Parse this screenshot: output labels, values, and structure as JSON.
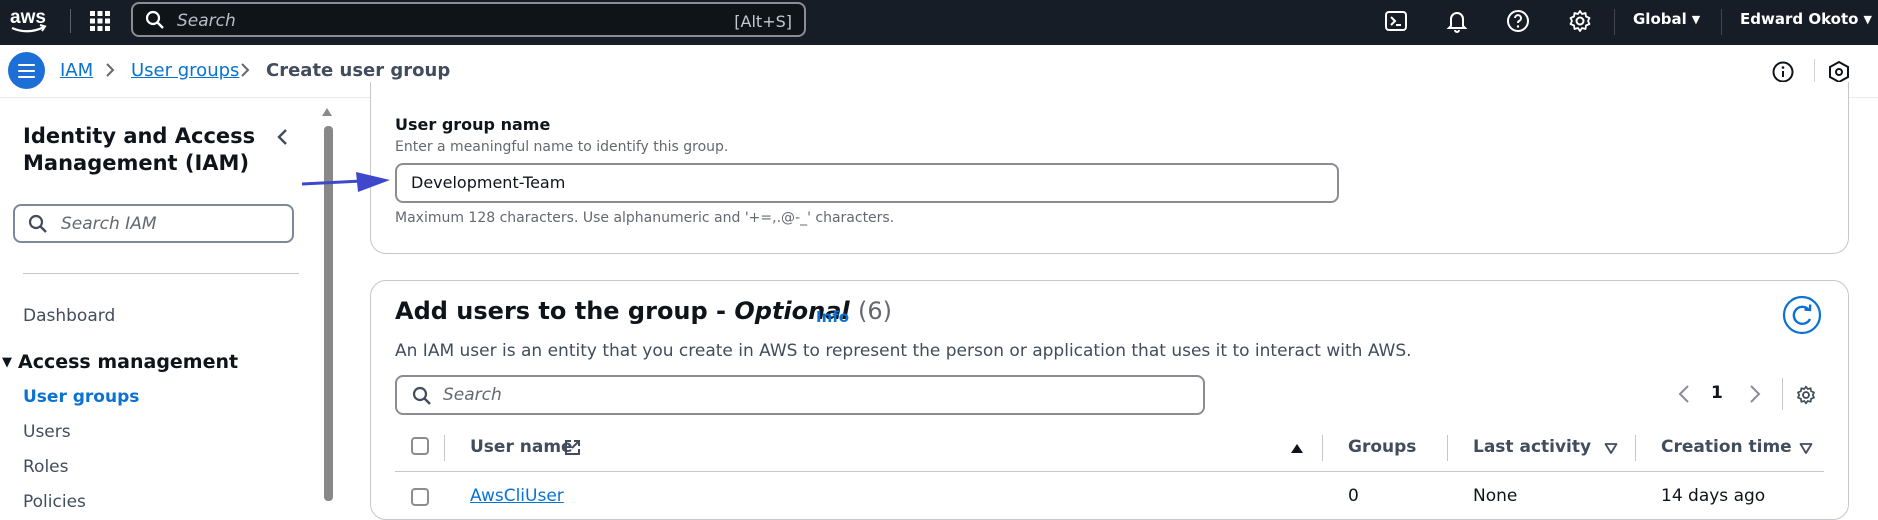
{
  "topnav": {
    "logo": "aws",
    "search_placeholder": "Search",
    "search_shortcut": "[Alt+S]",
    "region": "Global",
    "user": "Edward Okoto",
    "icons": [
      "cloudshell-icon",
      "bell-icon",
      "help-icon",
      "gear-icon"
    ]
  },
  "breadcrumb": {
    "items": [
      "IAM",
      "User groups",
      "Create user group"
    ]
  },
  "sidebar": {
    "title": "Identity and Access Management (IAM)",
    "search_placeholder": "Search IAM",
    "dashboard": "Dashboard",
    "section": "Access management",
    "items": [
      "User groups",
      "Users",
      "Roles",
      "Policies"
    ],
    "active": "User groups"
  },
  "group_name": {
    "label": "User group name",
    "description": "Enter a meaningful name to identify this group.",
    "value": "Development-Team",
    "constraint": "Maximum 128 characters. Use alphanumeric and '+=,.@-_' characters."
  },
  "add_users": {
    "title": "Add users to the group -",
    "optional": "Optional",
    "count": "(6)",
    "info": "Info",
    "description": "An IAM user is an entity that you create in AWS to represent the person or application that uses it to interact with AWS.",
    "search_placeholder": "Search",
    "page": "1",
    "columns": [
      "User name",
      "Groups",
      "Last activity",
      "Creation time"
    ],
    "rows": [
      {
        "user": "AwsCliUser",
        "groups": "0",
        "last_activity": "None",
        "created": "14 days ago"
      }
    ]
  },
  "colors": {
    "nav_bg": "#161d26",
    "link": "#0972d3",
    "accent": "#1d6fd8",
    "arrow": "#3f48cc"
  }
}
